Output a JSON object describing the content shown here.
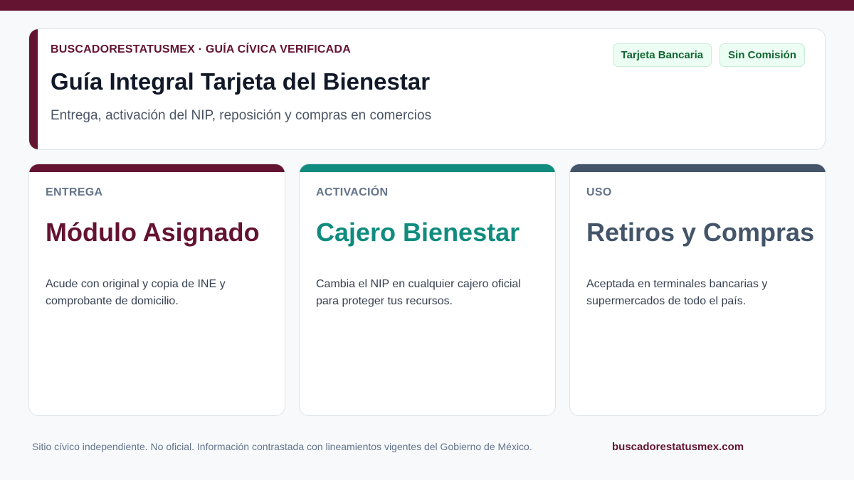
{
  "header": {
    "eyebrow": "BUSCADORESTATUSMEX · GUÍA CÍVICA VERIFICADA",
    "title": "Guía Integral Tarjeta del Bienestar",
    "subtitle": "Entrega, activación del NIP, reposición y compras en comercios",
    "badges": [
      "Tarjeta Bancaria",
      "Sin Comisión"
    ]
  },
  "cards": [
    {
      "label": "ENTREGA",
      "value": "Módulo Asignado",
      "description": "Acude con original y copia de INE y comprobante de domicilio.",
      "accent_color": "#641331"
    },
    {
      "label": "ACTIVACIÓN",
      "value": "Cajero Bienestar",
      "description": "Cambia el NIP en cualquier cajero oficial para proteger tus recursos.",
      "accent_color": "#0f8c7e"
    },
    {
      "label": "USO",
      "value": "Retiros y Compras",
      "description": "Aceptada en terminales bancarias y supermercados de todo el país.",
      "accent_color": "#445569"
    }
  ],
  "footer": {
    "note": "Sitio cívico independiente. No oficial. Información contrastada con lineamientos vigentes del Gobierno de México.",
    "link": "buscadorestatusmex.com"
  },
  "colors": {
    "brand": "#641331",
    "badge_text": "#116632",
    "badge_bg": "#ecfdf3"
  }
}
